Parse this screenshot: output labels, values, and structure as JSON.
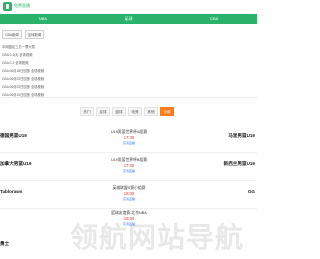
{
  "header": {
    "logo_text": "免费直播"
  },
  "nav": {
    "items": [
      "NBA",
      "足球",
      "CBA"
    ]
  },
  "news": {
    "tabs": [
      "CBA新闻",
      "足球新闻"
    ],
    "items": [
      "中网国足三方一票大赛",
      "CBA 0-2(3) 全场视频",
      "CBA 0-3 全场视频",
      "CBA 06月18日回放 全场视频",
      "CBA 06月02日回放 全场视频",
      "CBA 06月02日回放 全场视频",
      "CBA 06月10日回放 全场视频"
    ]
  },
  "filters": {
    "tabs": [
      "热门",
      "足球",
      "篮球",
      "电竞",
      "其他",
      "全部"
    ],
    "active_index": 5
  },
  "matches": [
    {
      "home": "德国男篮U19",
      "league": "U19男篮世界杯A组赛",
      "time": "17:30",
      "link": "高清直播",
      "away": "马里男篮U19"
    },
    {
      "home": "加拿大男篮U19",
      "league": "U19男篮世界杯B组赛",
      "time": "17:30",
      "link": "高清直播",
      "away": "新西兰男篮U19"
    },
    {
      "home": "Tabloraws",
      "league": "英雄联盟S赛小组赛",
      "time": "18:00",
      "link": "高清直播",
      "away": "GG"
    },
    {
      "home": "勇士",
      "league": "篮球友谊赛-北京NBA",
      "time": "18:00",
      "link": "高清直播",
      "away": ""
    }
  ],
  "watermark": "领航网站导航"
}
